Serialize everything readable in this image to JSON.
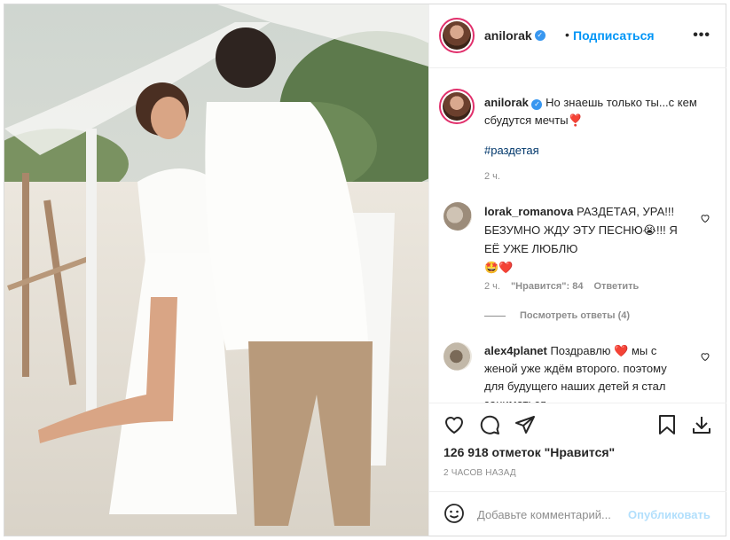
{
  "header": {
    "username": "anilorak",
    "separator": "•",
    "follow_label": "Подписаться",
    "more_label": "•••"
  },
  "caption": {
    "username": "anilorak",
    "text": "Но знаешь только ты...с кем сбудутся мечты",
    "emoji": "❣️",
    "hashtag": "#раздетая",
    "time": "2 ч."
  },
  "comments": [
    {
      "username": "lorak_romanova",
      "text": "РАЗДЕТАЯ, УРА!!! БЕЗУМНО ЖДУ ЭТУ ПЕСНЮ",
      "emoji1": "😭",
      "text2": "!!! Я ЕЁ УЖЕ ЛЮБЛЮ",
      "emoji2": "🤩❤️",
      "time": "2 ч.",
      "likes": "\"Нравится\": 84",
      "reply_label": "Ответить",
      "view_replies": "Посмотреть ответы (4)"
    },
    {
      "username": "alex4planet",
      "text": "Поздравлю",
      "emoji": "❤️",
      "text2": "мы с женой уже ждём второго. поэтому для будущего наших детей я стал заниматься"
    }
  ],
  "stats": {
    "likes": "126 918 отметок \"Нравится\"",
    "ago": "2 ЧАСОВ НАЗАД"
  },
  "add_comment": {
    "placeholder": "Добавьте комментарий...",
    "publish_label": "Опубликовать"
  },
  "colors": {
    "accent": "#0095f6",
    "verified": "#3897f0",
    "publish_disabled": "#b2dffc",
    "muted": "#8e8e8e",
    "heart": "#ed4956"
  },
  "icons": {
    "actions": [
      "heart-icon",
      "comment-icon",
      "share-icon",
      "bookmark-icon",
      "download-icon"
    ],
    "emoji": "smile-icon"
  }
}
